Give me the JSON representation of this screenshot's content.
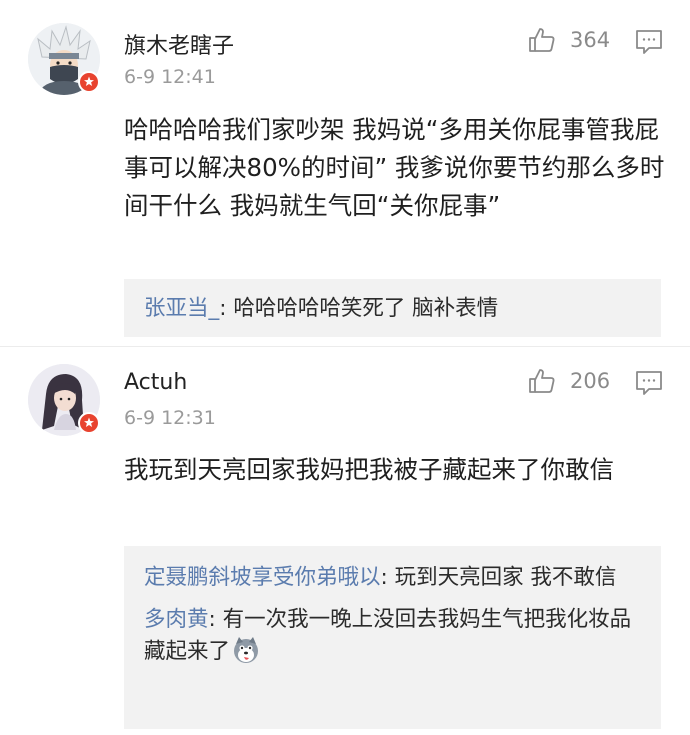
{
  "comments": [
    {
      "username": "旗木老瞎子",
      "time": "6-9 12:41",
      "likes": "364",
      "content": "哈哈哈哈我们家吵架 我妈说“多用关你屁事管我屁事可以解决80%的时间” 我爹说你要节约那么多时间干什么 我妈就生气回“关你屁事”",
      "replies": [
        {
          "name": "张亚当_",
          "sep": ": ",
          "text": "哈哈哈哈哈笑死了  脑补表情"
        }
      ]
    },
    {
      "username": "Actuh",
      "time": "6-9 12:31",
      "likes": "206",
      "content": "我玩到天亮回家我妈把我被子藏起来了你敢信",
      "replies": [
        {
          "name": "定聂鹏斜坡享受你弟哦以",
          "sep": ": ",
          "text": "玩到天亮回家  我不敢信"
        },
        {
          "name": "多肉黄",
          "sep": ": ",
          "text": "有一次我一晚上没回去我妈生气把我化妆品藏起来了"
        }
      ]
    }
  ],
  "icons": {
    "like": "thumbs-up-icon",
    "reply": "comment-bubble-icon",
    "verified": "verified-badge-icon",
    "emoji": "husky-face-emoji"
  },
  "colors": {
    "reply_name": "#5b7cae",
    "time": "#9a9a9a",
    "reply_bg": "#f2f2f2",
    "badge": "#e8432f"
  }
}
